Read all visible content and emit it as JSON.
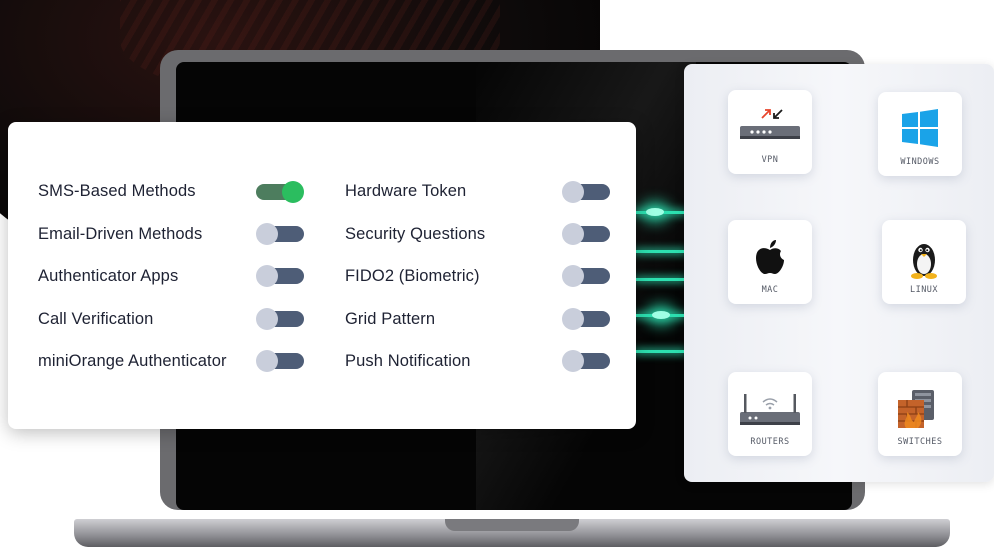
{
  "auth_methods": {
    "left": [
      {
        "label": "SMS-Based Methods",
        "enabled": true
      },
      {
        "label": "Email-Driven Methods",
        "enabled": false
      },
      {
        "label": "Authenticator Apps",
        "enabled": false
      },
      {
        "label": "Call Verification",
        "enabled": false
      },
      {
        "label": "miniOrange Authenticator",
        "enabled": false
      }
    ],
    "right": [
      {
        "label": "Hardware Token",
        "enabled": false
      },
      {
        "label": "Security Questions",
        "enabled": false
      },
      {
        "label": "FIDO2 (Biometric)",
        "enabled": false
      },
      {
        "label": "Grid Pattern",
        "enabled": false
      },
      {
        "label": "Push Notification",
        "enabled": false
      }
    ]
  },
  "platforms": [
    {
      "label": "VPN",
      "icon": "vpn-device-icon"
    },
    {
      "label": "WINDOWS",
      "icon": "windows-logo-icon"
    },
    {
      "label": "MAC",
      "icon": "apple-logo-icon"
    },
    {
      "label": "LINUX",
      "icon": "linux-penguin-icon"
    },
    {
      "label": "ROUTERS",
      "icon": "router-icon"
    },
    {
      "label": "SWITCHES",
      "icon": "firewall-switch-icon"
    }
  ],
  "colors": {
    "toggle_on": "#2bbd5f",
    "toggle_off_track": "#4e5d77",
    "glow": "#2de0b0",
    "windows_blue": "#1aa3e8"
  }
}
